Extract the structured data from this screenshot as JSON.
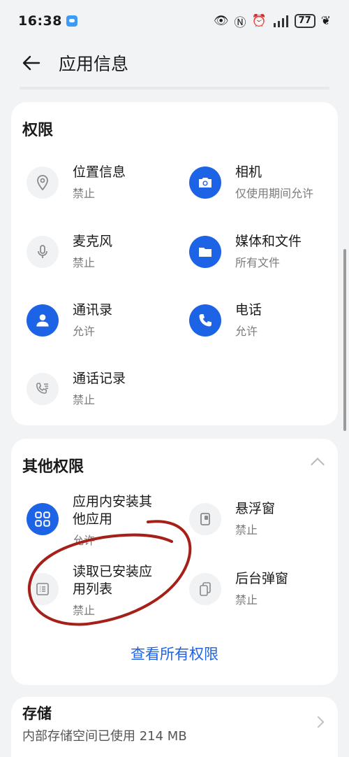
{
  "status_bar": {
    "time": "16:38",
    "battery": "77",
    "icons": [
      "chat-app-icon",
      "eye-icon",
      "nfc-icon",
      "alarm-icon",
      "signal-icon",
      "leaf-icon"
    ]
  },
  "header": {
    "title": "应用信息"
  },
  "permissions": {
    "title": "权限",
    "items": [
      {
        "name": "位置信息",
        "status": "禁止",
        "icon": "location-icon",
        "style": "grey"
      },
      {
        "name": "相机",
        "status": "仅使用期间允许",
        "icon": "camera-icon",
        "style": "blue"
      },
      {
        "name": "麦克风",
        "status": "禁止",
        "icon": "microphone-icon",
        "style": "grey"
      },
      {
        "name": "媒体和文件",
        "status": "所有文件",
        "icon": "folder-icon",
        "style": "blue"
      },
      {
        "name": "通讯录",
        "status": "允许",
        "icon": "contacts-icon",
        "style": "blue"
      },
      {
        "name": "电话",
        "status": "允许",
        "icon": "phone-icon",
        "style": "blue"
      },
      {
        "name": "通话记录",
        "status": "禁止",
        "icon": "call-log-icon",
        "style": "grey"
      }
    ]
  },
  "other_permissions": {
    "title": "其他权限",
    "items": [
      {
        "name": "应用内安装其他应用",
        "status": "允许",
        "icon": "install-apps-icon",
        "style": "blue"
      },
      {
        "name": "悬浮窗",
        "status": "禁止",
        "icon": "floating-window-icon",
        "style": "grey"
      },
      {
        "name": "读取已安装应用列表",
        "status": "禁止",
        "icon": "app-list-icon",
        "style": "grey"
      },
      {
        "name": "后台弹窗",
        "status": "禁止",
        "icon": "background-popup-icon",
        "style": "grey"
      }
    ],
    "view_all": "查看所有权限"
  },
  "storage": {
    "title": "存储",
    "subtitle": "内部存储空间已使用 214 MB"
  },
  "colors": {
    "accent": "#1d63e6",
    "annotation": "#a6201a",
    "background": "#f1f3f5"
  }
}
